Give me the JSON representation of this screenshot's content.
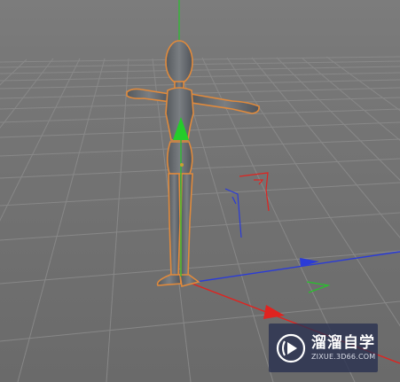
{
  "viewport": {
    "background_sky": "#7d7d7d",
    "background_floor": "#6c6c6c",
    "grid_color": "#8e8e8e",
    "selection_outline": "#e08a3c"
  },
  "figure": {
    "body_color": "#6b6f73",
    "state": "selected"
  },
  "axes": {
    "x_color": "#e0231f",
    "y_color": "#27c22b",
    "z_color": "#2a3bd8"
  },
  "watermark": {
    "title": "溜溜自学",
    "url": "ZIXUE.3D66.COM",
    "logo_icon": "play-icon"
  }
}
